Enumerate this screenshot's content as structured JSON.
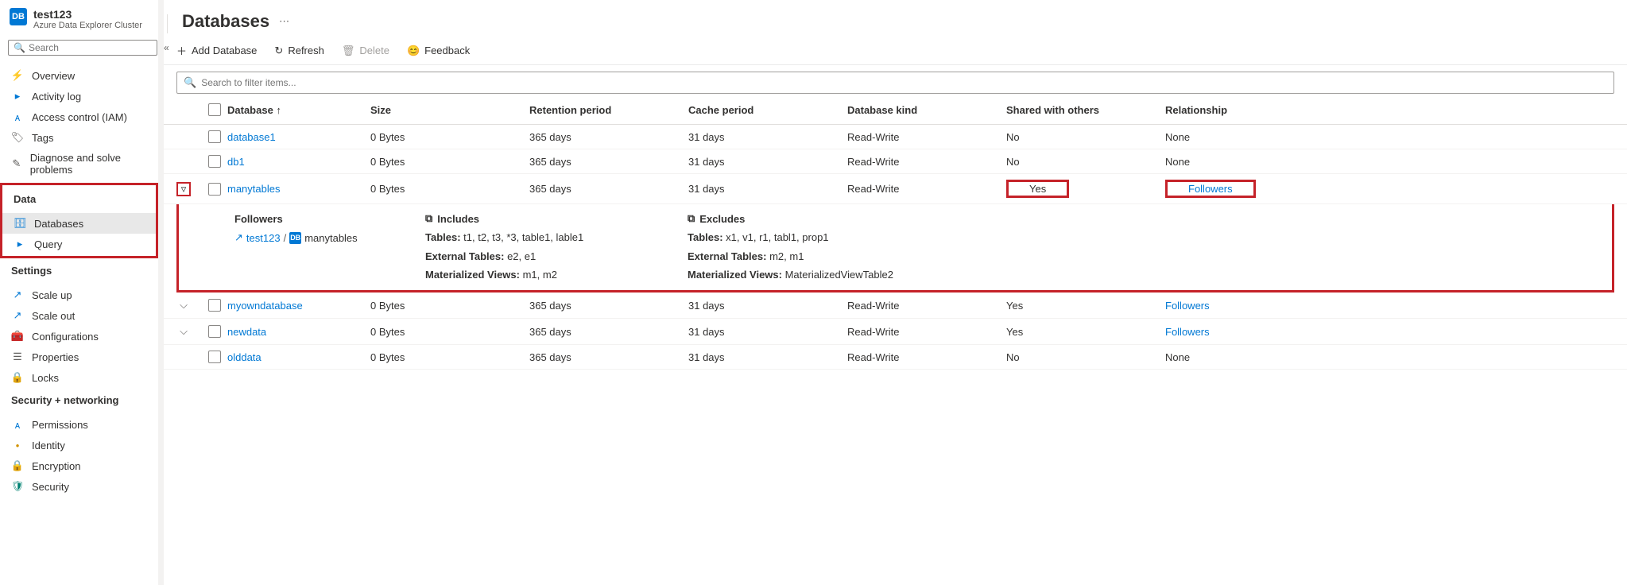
{
  "header": {
    "cluster_name": "test123",
    "cluster_sub": "Azure Data Explorer Cluster",
    "sidebar_search_placeholder": "Search",
    "page_title": "Databases"
  },
  "toolbar": {
    "add": "Add Database",
    "refresh": "Refresh",
    "delete": "Delete",
    "feedback": "Feedback",
    "filter_placeholder": "Search to filter items..."
  },
  "sidebar": {
    "items_top": [
      {
        "label": "Overview",
        "icon": "⚡",
        "css": "icon-blue"
      },
      {
        "label": "Activity log",
        "icon": "▸",
        "css": "icon-blue"
      },
      {
        "label": "Access control (IAM)",
        "icon": "ᴀ",
        "css": "icon-blue"
      },
      {
        "label": "Tags",
        "icon": "🏷",
        "css": "icon-grey"
      },
      {
        "label": "Diagnose and solve problems",
        "icon": "✎",
        "css": "icon-grey"
      }
    ],
    "section_data": "Data",
    "items_data": [
      {
        "label": "Databases",
        "icon": "🗄",
        "css": "icon-blue"
      },
      {
        "label": "Query",
        "icon": "▸",
        "css": "icon-blue"
      }
    ],
    "section_settings": "Settings",
    "items_settings": [
      {
        "label": "Scale up",
        "icon": "↗",
        "css": "icon-blue"
      },
      {
        "label": "Scale out",
        "icon": "↗",
        "css": "icon-blue"
      },
      {
        "label": "Configurations",
        "icon": "🧰",
        "css": "icon-orange"
      },
      {
        "label": "Properties",
        "icon": "☰",
        "css": "icon-grey"
      },
      {
        "label": "Locks",
        "icon": "🔒",
        "css": "icon-grey"
      }
    ],
    "section_security": "Security + networking",
    "items_security": [
      {
        "label": "Permissions",
        "icon": "ᴀ",
        "css": "icon-blue"
      },
      {
        "label": "Identity",
        "icon": "•",
        "css": "icon-orange"
      },
      {
        "label": "Encryption",
        "icon": "🔒",
        "css": "icon-grey"
      },
      {
        "label": "Security",
        "icon": "🛡",
        "css": "icon-teal"
      }
    ]
  },
  "columns": {
    "c1": "Database ↑",
    "c2": "Size",
    "c3": "Retention period",
    "c4": "Cache period",
    "c5": "Database kind",
    "c6": "Shared with others",
    "c7": "Relationship"
  },
  "rows": [
    {
      "name": "database1",
      "size": "0 Bytes",
      "retention": "365 days",
      "cache": "31 days",
      "kind": "Read-Write",
      "shared": "No",
      "rel": "None",
      "rel_link": false,
      "expandable": false
    },
    {
      "name": "db1",
      "size": "0 Bytes",
      "retention": "365 days",
      "cache": "31 days",
      "kind": "Read-Write",
      "shared": "No",
      "rel": "None",
      "rel_link": false,
      "expandable": false
    },
    {
      "name": "manytables",
      "size": "0 Bytes",
      "retention": "365 days",
      "cache": "31 days",
      "kind": "Read-Write",
      "shared": "Yes",
      "rel": "Followers",
      "rel_link": true,
      "expandable": true,
      "expanded": true,
      "highlight_shared": true,
      "highlight_rel": true
    },
    {
      "name": "myowndatabase",
      "size": "0 Bytes",
      "retention": "365 days",
      "cache": "31 days",
      "kind": "Read-Write",
      "shared": "Yes",
      "rel": "Followers",
      "rel_link": true,
      "expandable": true
    },
    {
      "name": "newdata",
      "size": "0 Bytes",
      "retention": "365 days",
      "cache": "31 days",
      "kind": "Read-Write",
      "shared": "Yes",
      "rel": "Followers",
      "rel_link": true,
      "expandable": true
    },
    {
      "name": "olddata",
      "size": "0 Bytes",
      "retention": "365 days",
      "cache": "31 days",
      "kind": "Read-Write",
      "shared": "No",
      "rel": "None",
      "rel_link": false,
      "expandable": false
    }
  ],
  "panel": {
    "head_followers": "Followers",
    "head_includes": "Includes",
    "head_excludes": "Excludes",
    "follower_link": "test123",
    "follower_db": "manytables",
    "inc_tables_label": "Tables:",
    "inc_tables": "t1, t2, t3, *3, table1, lable1",
    "inc_ext_label": "External Tables:",
    "inc_ext": "e2, e1",
    "inc_mv_label": "Materialized Views:",
    "inc_mv": "m1, m2",
    "exc_tables_label": "Tables:",
    "exc_tables": "x1, v1, r1, tabl1, prop1",
    "exc_ext_label": "External Tables:",
    "exc_ext": "m2, m1",
    "exc_mv_label": "Materialized Views:",
    "exc_mv": "MaterializedViewTable2"
  }
}
